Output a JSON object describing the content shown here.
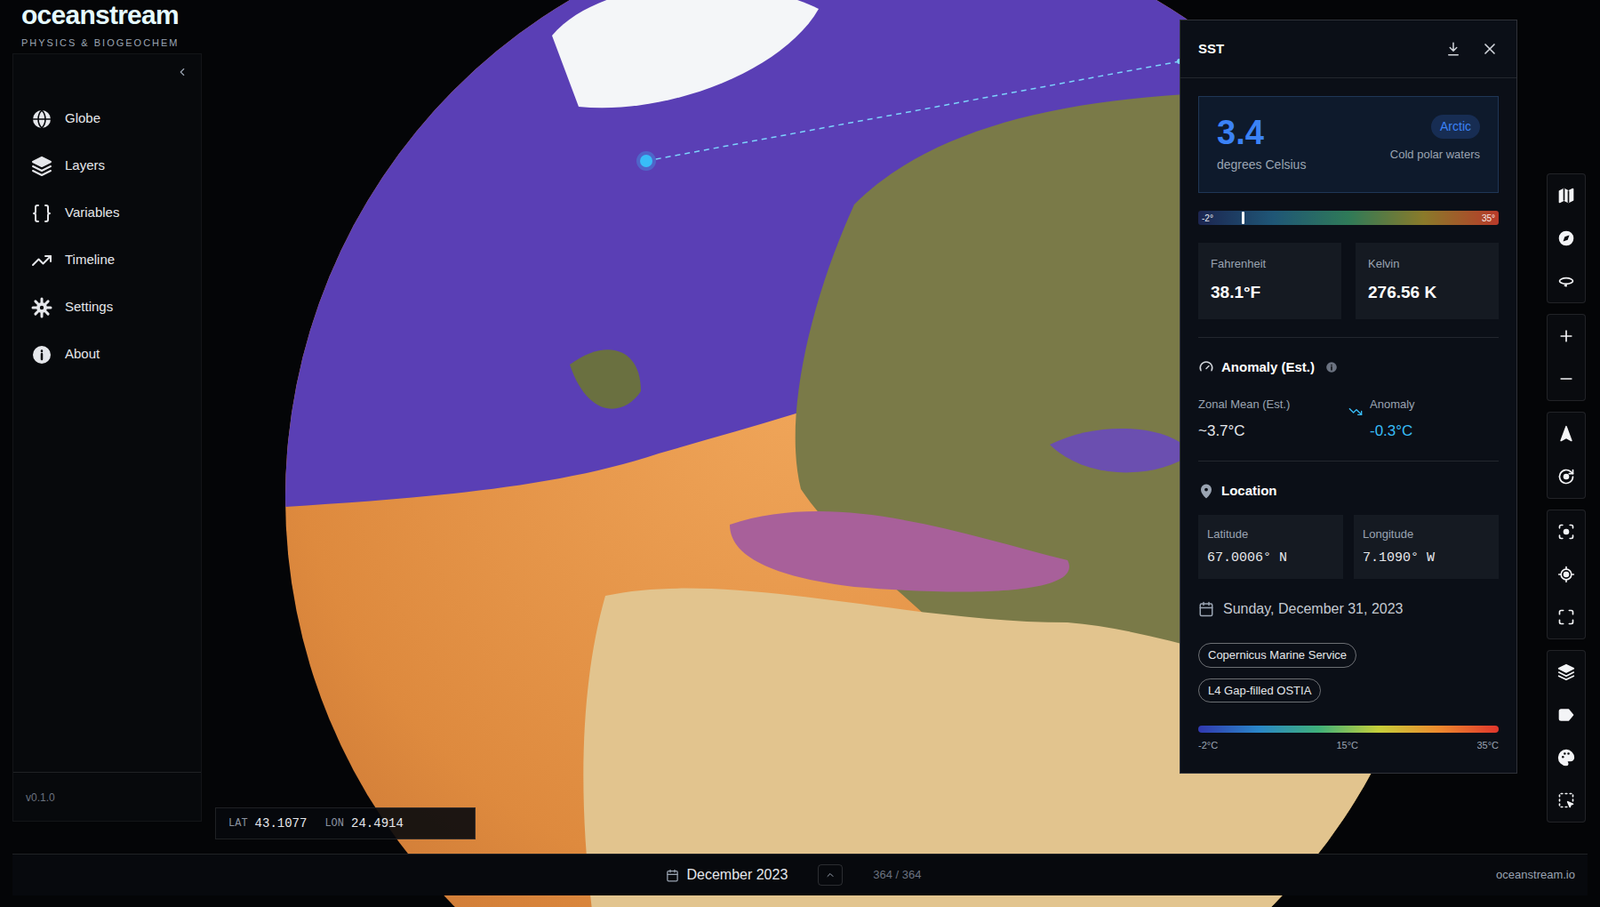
{
  "app": {
    "logo": "oceanstream",
    "subtitle": "PHYSICS & BIOGEOCHEM",
    "version": "v0.1.0"
  },
  "sidebar": {
    "items": [
      {
        "label": "Globe"
      },
      {
        "label": "Layers"
      },
      {
        "label": "Variables"
      },
      {
        "label": "Timeline"
      },
      {
        "label": "Settings"
      },
      {
        "label": "About"
      }
    ]
  },
  "cursor": {
    "lat_label": "LAT",
    "lat": "43.1077",
    "lon_label": "LON",
    "lon": "24.4914"
  },
  "timeline": {
    "date": "December 2023",
    "frame": "364 / 364",
    "link": "oceanstream.io"
  },
  "panel": {
    "title": "SST",
    "value": "3.4",
    "unit": "degrees Celsius",
    "region": "Arctic",
    "region_desc": "Cold polar waters",
    "scale": {
      "min": "-2°",
      "max": "35°",
      "level": 0.146
    },
    "fahrenheit": {
      "label": "Fahrenheit",
      "value": "38.1°F"
    },
    "kelvin": {
      "label": "Kelvin",
      "value": "276.56 K"
    },
    "anomaly": {
      "title": "Anomaly (Est.)",
      "zonal_label": "Zonal Mean (Est.)",
      "zonal_value": "~3.7°C",
      "anomaly_label": "Anomaly",
      "anomaly_value": "-0.3°C"
    },
    "location": {
      "title": "Location",
      "lat_label": "Latitude",
      "lat": "67.0006° N",
      "lon_label": "Longitude",
      "lon": "7.1090° W"
    },
    "date": "Sunday, December 31, 2023",
    "tags": [
      "Copernicus Marine Service",
      "L4 Gap-filled OSTIA"
    ],
    "legend": [
      "-2°C",
      "15°C",
      "35°C"
    ]
  }
}
